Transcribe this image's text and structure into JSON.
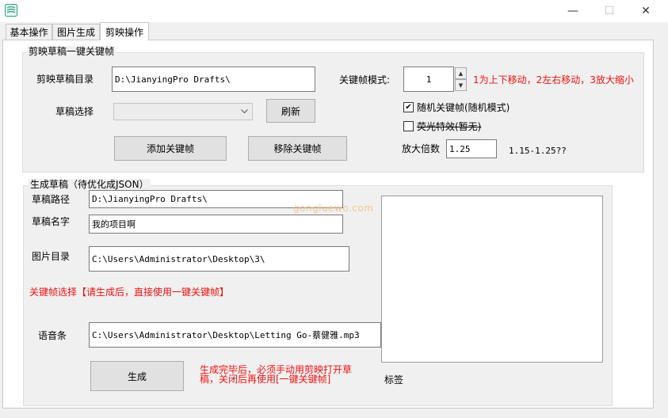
{
  "window": {
    "minimize_glyph": "—",
    "maximize_glyph": "☐",
    "close_glyph": "✕"
  },
  "tabs": [
    {
      "label": "基本操作"
    },
    {
      "label": "图片生成"
    },
    {
      "label": "剪映操作"
    }
  ],
  "keyframe_group": {
    "title": "剪映草稿一键关键帧",
    "draft_dir_label": "剪映草稿目录",
    "draft_dir_value": "D:\\JianyingPro Drafts\\",
    "draft_select_label": "草稿选择",
    "draft_select_value": "",
    "refresh_label": "刷新",
    "add_keyframe_label": "添加关键帧",
    "remove_keyframe_label": "移除关键帧",
    "mode_label": "关键帧模式:",
    "mode_value": "1",
    "mode_hint": "1为上下移动，2左右移动，3放大缩小",
    "random_keyframe_label": "随机关键帧(随机模式)",
    "random_keyframe_checked": true,
    "glow_effect_label": "荧光特效(暂无)",
    "glow_effect_checked": false,
    "zoom_label": "放大倍数",
    "zoom_value": "1.25",
    "zoom_range": "1.15-1.25??"
  },
  "generate_group": {
    "title": "生成草稿（待优化成JSON）",
    "draft_path_label": "草稿路径",
    "draft_path_value": "D:\\JianyingPro Drafts\\",
    "draft_name_label": "草稿名字",
    "draft_name_value": "我的项目啊",
    "image_dir_label": "图片目录",
    "image_dir_value": "C:\\Users\\Administrator\\Desktop\\3\\",
    "keyframe_hint": "关键帧选择【请生成后，直接使用一键关键帧】",
    "voice_label": "语音条",
    "voice_value": "C:\\Users\\Administrator\\Desktop\\Letting Go-蔡健雅.mp3",
    "generate_label": "生成",
    "generate_hint_line1": "生成完毕后，必须手动用剪映打开草",
    "generate_hint_line2": "稿，关闭后再使用[一键关键帧]",
    "tag_label": "标签"
  },
  "watermark": "gongluewo.com",
  "colors": {
    "hint_red": "#ee1111",
    "watermark": "#f0c890"
  }
}
